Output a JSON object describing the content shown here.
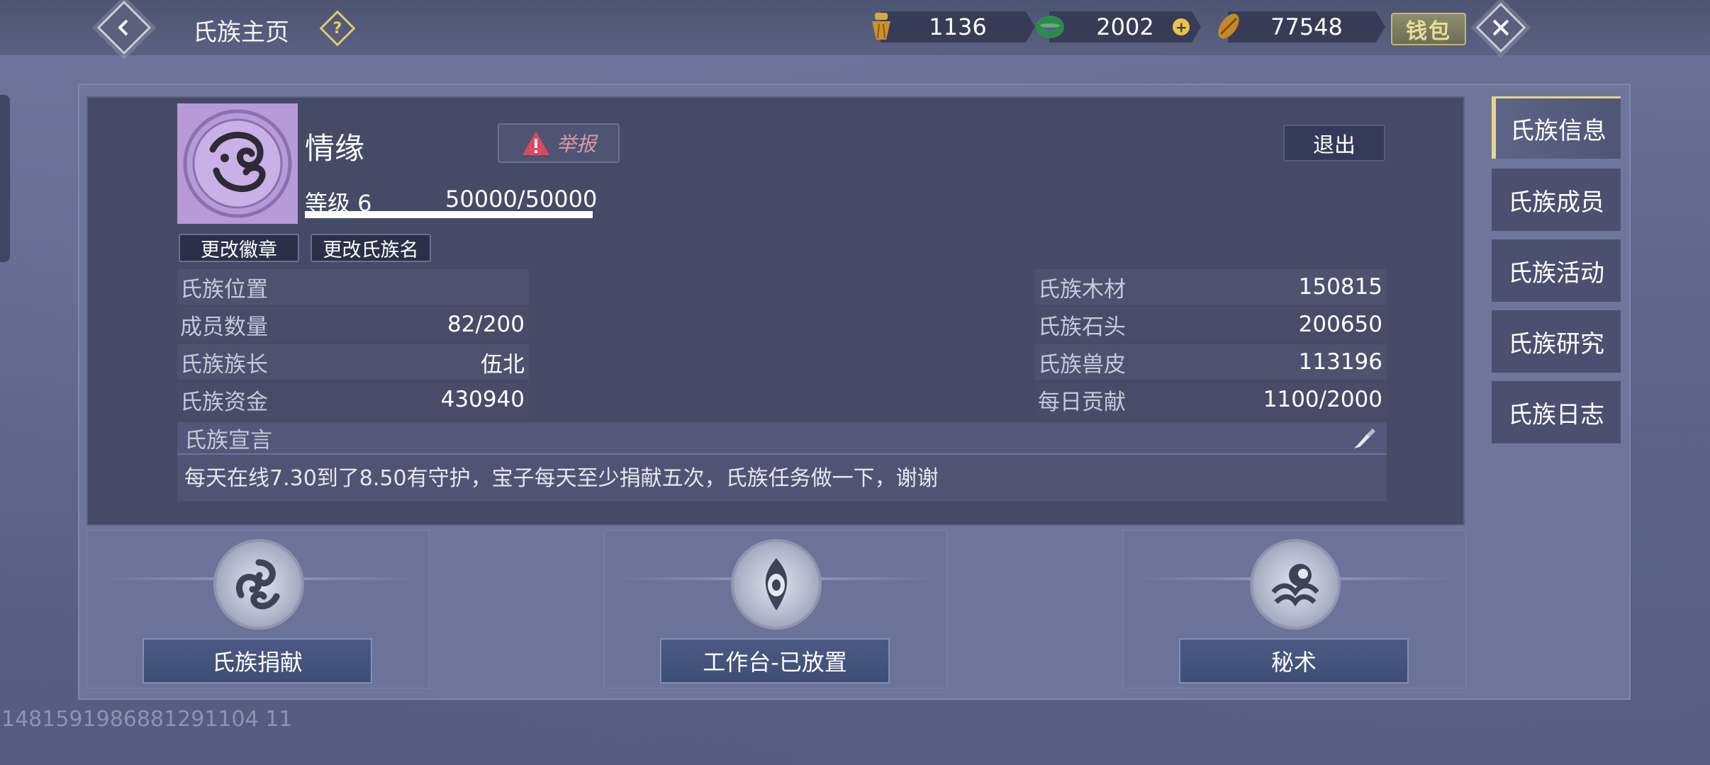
{
  "header": {
    "title": "氏族主页",
    "help_icon": "question-icon",
    "resources": [
      {
        "icon": "gold-tassel-icon",
        "value": "1136"
      },
      {
        "icon": "jade-coin-icon",
        "value": "2002"
      },
      {
        "icon": "copper-coin-icon",
        "value": "77548"
      }
    ],
    "wallet_label": "钱包"
  },
  "clan": {
    "name": "情缘",
    "report_label": "举报",
    "level_label": "等级 6",
    "level_progress": "50000/50000",
    "level_fraction": 1.0,
    "quit_label": "退出",
    "change_emblem_label": "更改徽章",
    "change_name_label": "更改氏族名",
    "left_info": [
      {
        "label": "氏族位置",
        "value": ""
      },
      {
        "label": "成员数量",
        "value": "82/200"
      },
      {
        "label": "氏族族长",
        "value": "伍北"
      },
      {
        "label": "氏族资金",
        "value": "430940"
      }
    ],
    "right_info": [
      {
        "label": "氏族木材",
        "value": "150815"
      },
      {
        "label": "氏族石头",
        "value": "200650"
      },
      {
        "label": "氏族兽皮",
        "value": "113196"
      },
      {
        "label": "每日贡献",
        "value": "1100/2000"
      }
    ],
    "declaration_label": "氏族宣言",
    "declaration_text": "每天在线7.30到了8.50有守护，宝子每天至少捐献五次，氏族任务做一下，谢谢"
  },
  "actions": [
    {
      "label": "氏族捐献",
      "icon": "swirl-emblem-icon"
    },
    {
      "label": "工作台-已放置",
      "icon": "eye-emblem-icon"
    },
    {
      "label": "秘术",
      "icon": "moon-wave-emblem-icon"
    }
  ],
  "tabs": [
    {
      "label": "氏族信息",
      "active": true
    },
    {
      "label": "氏族成员",
      "active": false
    },
    {
      "label": "氏族活动",
      "active": false
    },
    {
      "label": "氏族研究",
      "active": false
    },
    {
      "label": "氏族日志",
      "active": false
    }
  ],
  "footer_id": "1481591986881291104 11",
  "colors": {
    "accent_gold": "#e8d38a",
    "progress_fill": "#ffffff",
    "report_red": "#d84a5c"
  }
}
